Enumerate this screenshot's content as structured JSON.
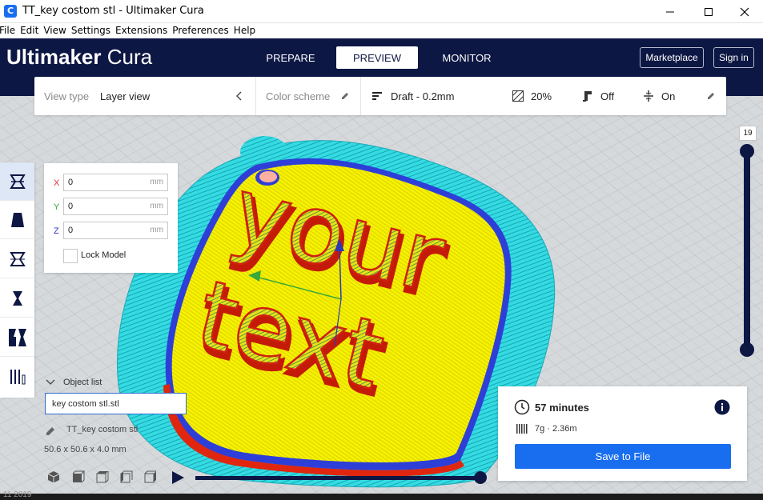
{
  "window": {
    "title": "TT_key costom stl - Ultimaker Cura",
    "minimize_glyph": "minimize-icon",
    "maximize_glyph": "maximize-icon",
    "close_glyph": "close-icon"
  },
  "menu": [
    "File",
    "Edit",
    "View",
    "Settings",
    "Extensions",
    "Preferences",
    "Help"
  ],
  "header": {
    "logo_bold": "Ultimaker",
    "logo_light": "Cura",
    "tabs": [
      {
        "label": "PREPARE",
        "active": false
      },
      {
        "label": "PREVIEW",
        "active": true
      },
      {
        "label": "MONITOR",
        "active": false
      }
    ],
    "marketplace_label": "Marketplace",
    "signin_label": "Sign in"
  },
  "settings_bar": {
    "view_type_label": "View type",
    "view_type_value": "Layer view",
    "color_scheme_label": "Color scheme",
    "profile": "Draft - 0.2mm",
    "infill": "20%",
    "support": "Off",
    "adhesion": "On"
  },
  "move_panel": {
    "x_label": "X",
    "x_value": "0",
    "y_label": "Y",
    "y_value": "0",
    "z_label": "Z",
    "z_value": "0",
    "unit": "mm",
    "lock_label": "Lock Model"
  },
  "object_list": {
    "header": "Object list",
    "filename": "key costom stl.stl",
    "object_name": "TT_key costom stl",
    "dimensions": "50.6 x 50.6 x 4.0 mm"
  },
  "layer_slider": {
    "current_layer": "19"
  },
  "print_info": {
    "time": "57 minutes",
    "material": "7g · 2.36m",
    "save_label": "Save to File"
  },
  "model_text": {
    "line1": "your",
    "line2": "text"
  },
  "taskbar": {
    "fragment": "11 2019"
  },
  "colors": {
    "header_bg": "#0d1744",
    "accent": "#196ef0",
    "skirt": "#30d8e0",
    "infill": "#f6f000",
    "wall": "#e0260e",
    "inner_wall": "#2e3fd8"
  }
}
